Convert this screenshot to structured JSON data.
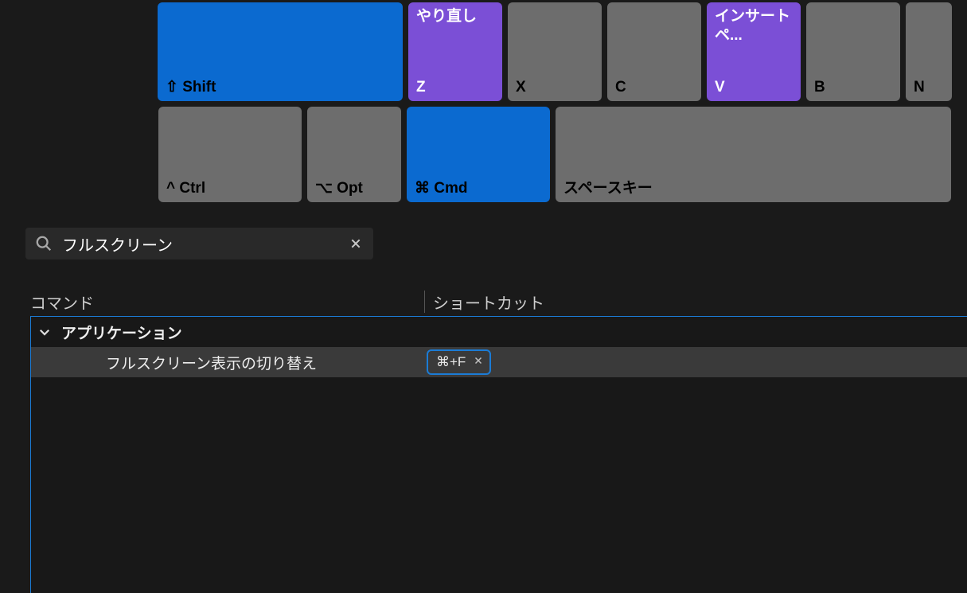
{
  "keyboard": {
    "row1": {
      "shift": {
        "label": "⇧ Shift"
      },
      "z": {
        "top": "やり直し",
        "bottom": "Z"
      },
      "x": {
        "bottom": "X"
      },
      "c": {
        "bottom": "C"
      },
      "v": {
        "top": "インサートペ...",
        "bottom": "V"
      },
      "b": {
        "bottom": "B"
      },
      "n": {
        "bottom": "N"
      }
    },
    "row2": {
      "ctrl": {
        "label": "^ Ctrl"
      },
      "opt": {
        "label": "⌥ Opt"
      },
      "cmd": {
        "label": "⌘ Cmd"
      },
      "space": {
        "label": "スペースキー"
      }
    }
  },
  "search": {
    "value": "フルスクリーン",
    "placeholder": ""
  },
  "table": {
    "headers": {
      "command": "コマンド",
      "shortcut": "ショートカット"
    },
    "group": "アプリケーション",
    "items": [
      {
        "label": "フルスクリーン表示の切り替え",
        "shortcut": "⌘+F"
      }
    ]
  }
}
